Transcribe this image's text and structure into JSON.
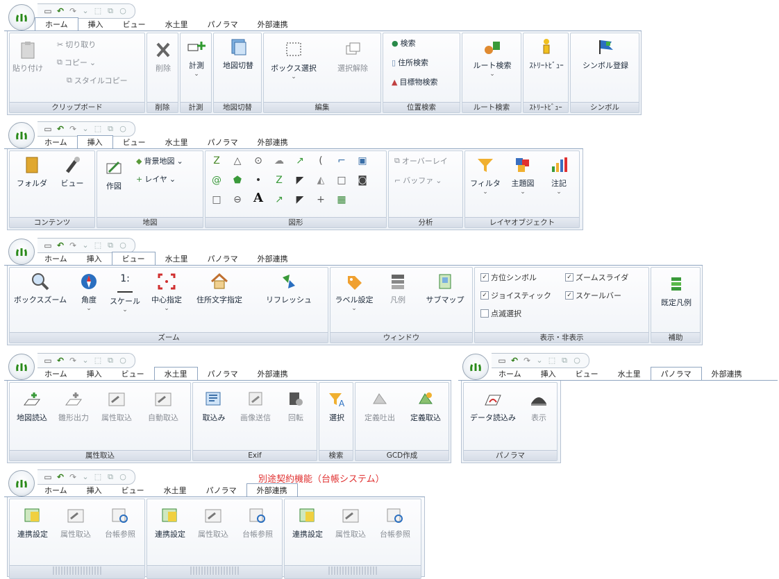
{
  "common": {
    "tabs": [
      "ホーム",
      "挿入",
      "ビュー",
      "水土里",
      "パノラマ",
      "外部連携"
    ]
  },
  "home": {
    "clipboard": {
      "paste": "貼り付け",
      "cut": "切り取り",
      "copy": "コピー",
      "style_copy": "スタイルコピー",
      "title": "クリップボード"
    },
    "delete": {
      "label": "削除",
      "title": "削除"
    },
    "measure": {
      "label": "計測",
      "title": "計測"
    },
    "mapswitch": {
      "label": "地図切替",
      "title": "地図切替"
    },
    "edit": {
      "box_select": "ボックス選択",
      "deselect": "選択解除",
      "title": "編集"
    },
    "location": {
      "search": "検索",
      "address": "住所検索",
      "landmark": "目標物検索",
      "title": "位置検索"
    },
    "route": {
      "label": "ルート検索",
      "title": "ルート検索"
    },
    "street": {
      "label": "ｽﾄﾘｰﾄﾋﾞｭｰ",
      "title": "ｽﾄﾘｰﾄﾋﾞｭｰ"
    },
    "symbol": {
      "label": "シンボル登録",
      "title": "シンボル"
    }
  },
  "insert": {
    "contents": {
      "folder": "フォルダ",
      "view": "ビュー",
      "title": "コンテンツ"
    },
    "map": {
      "draw": "作図",
      "bgmap": "背景地図",
      "layer": "レイヤ",
      "title": "地図"
    },
    "shapes": {
      "title": "図形",
      "text": "A"
    },
    "analysis": {
      "overlay": "オーバーレイ",
      "buffer": "バッファ",
      "title": "分析"
    },
    "layerobj": {
      "filter": "フィルタ",
      "theme": "主題図",
      "note": "注記",
      "title": "レイヤオブジェクト"
    }
  },
  "view": {
    "zoom": {
      "box": "ボックスズーム",
      "angle": "角度",
      "scale": "スケール",
      "scale_icon": "1:",
      "center": "中心指定",
      "address_text": "住所文字指定",
      "refresh": "リフレッシュ",
      "title": "ズーム"
    },
    "window": {
      "label": "ラベル設定",
      "legend": "凡例",
      "submap": "サブマップ",
      "title": "ウィンドウ"
    },
    "display": {
      "compass": "方位シンボル",
      "zoomslider": "ズームスライダ",
      "joystick": "ジョイスティック",
      "scalebar": "スケールバー",
      "blink": "点滅選択",
      "title": "表示・非表示"
    },
    "aux": {
      "label": "既定凡例",
      "title": "補助"
    }
  },
  "mizu": {
    "attr": {
      "mapread": "地図読込",
      "shapeout": "雛形出力",
      "attrin": "属性取込",
      "autoin": "自動取込",
      "title": "属性取込"
    },
    "exif": {
      "import": "取込み",
      "imgsend": "画像送信",
      "rotate": "回転",
      "title": "Exif"
    },
    "search": {
      "select": "選択",
      "title": "検索"
    },
    "gcd": {
      "defout": "定義吐出",
      "defin": "定義取込",
      "title": "GCD作成"
    }
  },
  "panorama": {
    "dataread": "データ読込み",
    "show": "表示",
    "title": "パノラマ"
  },
  "external": {
    "note": "別途契約機能（台帳システム）",
    "link": "連携設定",
    "attrin": "属性取込",
    "ledger": "台帳参照"
  }
}
